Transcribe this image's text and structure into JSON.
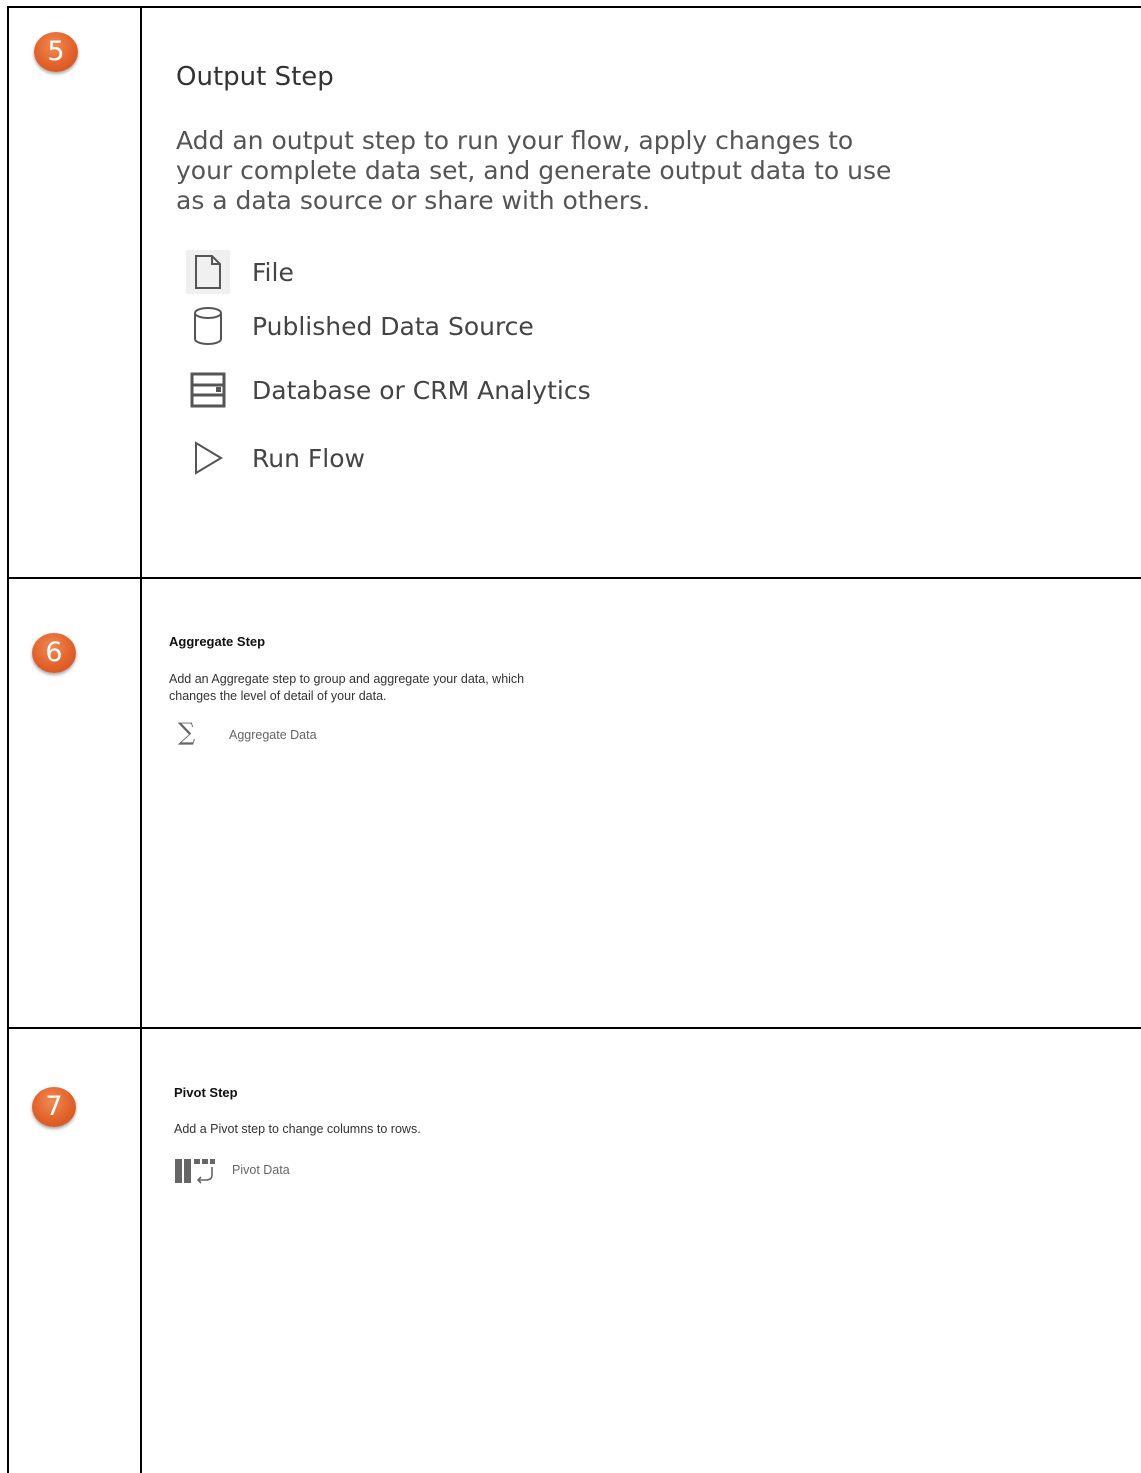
{
  "rows": [
    {
      "number": "5",
      "title": "Output Step",
      "description": "Add an output step to run your flow, apply changes to your complete data set, and generate output data to use as a data source or share with others.",
      "options": [
        {
          "label": "File",
          "icon": "file-icon"
        },
        {
          "label": "Published Data Source",
          "icon": "cylinder-icon"
        },
        {
          "label": "Database or  CRM Analytics",
          "icon": "database-table-icon"
        },
        {
          "label": "Run Flow",
          "icon": "play-icon"
        }
      ]
    },
    {
      "number": "6",
      "title": "Aggregate Step",
      "description": "Add an Aggregate step to group and aggregate your data, which changes the level of detail of your data.",
      "options": [
        {
          "label": "Aggregate Data",
          "icon": "sigma-icon"
        }
      ]
    },
    {
      "number": "7",
      "title": "Pivot Step",
      "description": "Add a Pivot step to change columns to rows.",
      "options": [
        {
          "label": "Pivot Data",
          "icon": "pivot-icon"
        }
      ]
    }
  ]
}
